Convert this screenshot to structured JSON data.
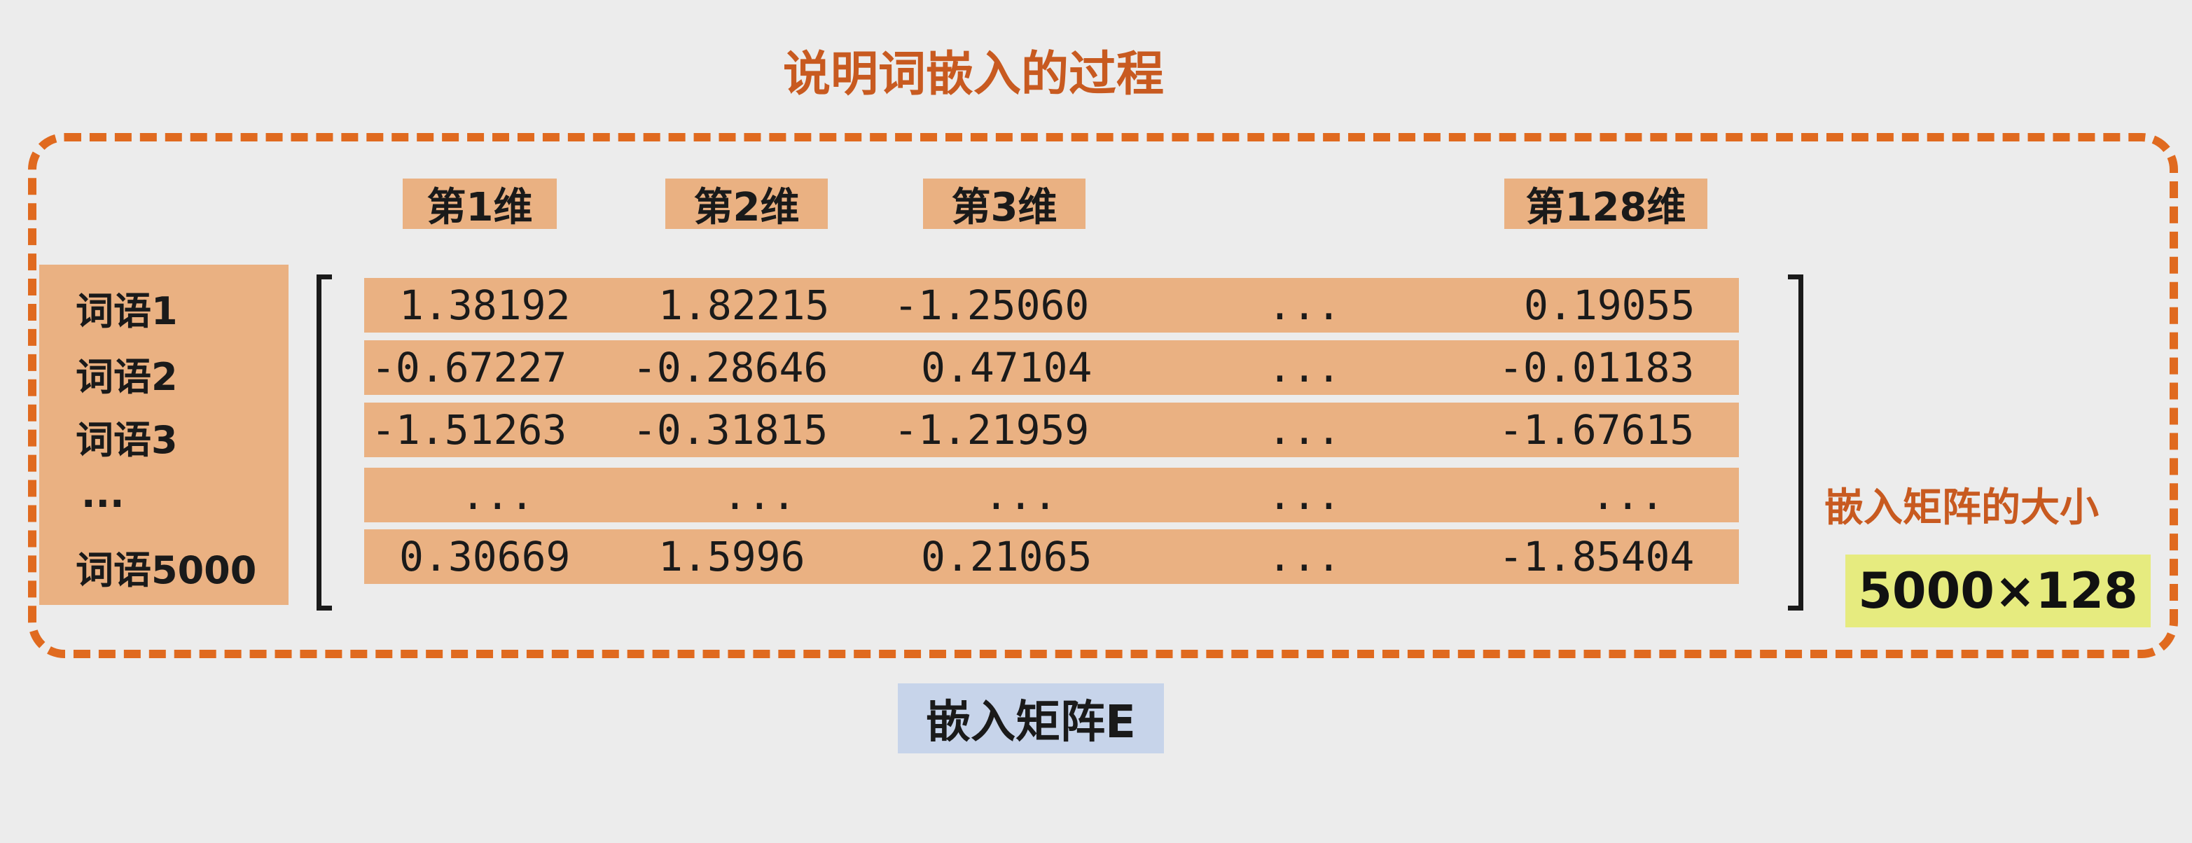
{
  "title": "说明词嵌入的过程",
  "columns": [
    "第1维",
    "第2维",
    "第3维",
    "第128维"
  ],
  "row_labels": [
    "词语1",
    "词语2",
    "词语3",
    "...",
    "词语5000"
  ],
  "rows": [
    [
      "1.38192",
      "1.82215",
      "-1.25060",
      "...",
      "0.19055"
    ],
    [
      "-0.67227",
      "-0.28646",
      "0.47104",
      "...",
      "-0.01183"
    ],
    [
      "-1.51263",
      "-0.31815",
      "-1.21959",
      "...",
      "-1.67615"
    ],
    [
      "...",
      "...",
      "...",
      "...",
      "..."
    ],
    [
      "0.30669",
      "1.5996",
      "0.21065",
      "...",
      "-1.85404"
    ]
  ],
  "size_label": "嵌入矩阵的大小",
  "size_value": "5000×128",
  "caption": "嵌入矩阵E",
  "colors": {
    "accent_orange": "#e06a1f",
    "title_orange": "#c85a20",
    "cell_fill": "#eab182",
    "size_highlight": "#e6eb7f",
    "caption_fill": "#c7d4ea",
    "background": "#ececec"
  }
}
